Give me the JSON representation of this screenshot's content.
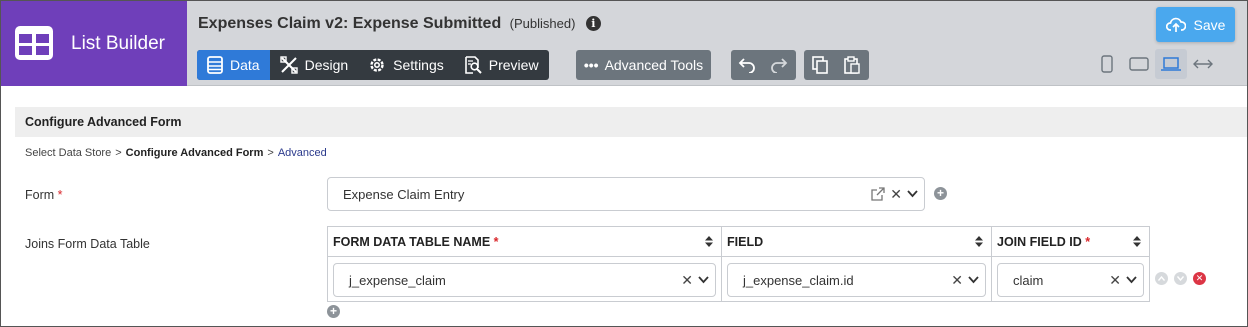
{
  "app": {
    "brand": "List Builder",
    "title": "Expenses Claim v2: Expense Submitted",
    "status": "(Published)",
    "save_label": "Save",
    "accent_color": "#2f7ad8",
    "brand_color": "#6f3fba"
  },
  "tabs": [
    {
      "label": "Data",
      "icon": "table-icon",
      "active": true
    },
    {
      "label": "Design",
      "icon": "design-tools-icon",
      "active": false
    },
    {
      "label": "Settings",
      "icon": "gear-icon",
      "active": false
    },
    {
      "label": "Preview",
      "icon": "preview-icon",
      "active": false
    }
  ],
  "toolbar": {
    "advanced_tools_label": "Advanced Tools"
  },
  "section": {
    "title": "Configure Advanced Form",
    "breadcrumb": [
      "Select Data Store",
      "Configure Advanced Form",
      "Advanced"
    ]
  },
  "form_field": {
    "label": "Form",
    "required_mark": "*",
    "value": "Expense Claim Entry"
  },
  "joins": {
    "label": "Joins Form Data Table",
    "columns": [
      {
        "label": "FORM DATA TABLE NAME",
        "required": "*"
      },
      {
        "label": "FIELD",
        "required": ""
      },
      {
        "label": "JOIN FIELD ID",
        "required": "*"
      }
    ],
    "rows": [
      {
        "table_name": "j_expense_claim",
        "field": "j_expense_claim.id",
        "join_field_id": "claim"
      }
    ]
  }
}
